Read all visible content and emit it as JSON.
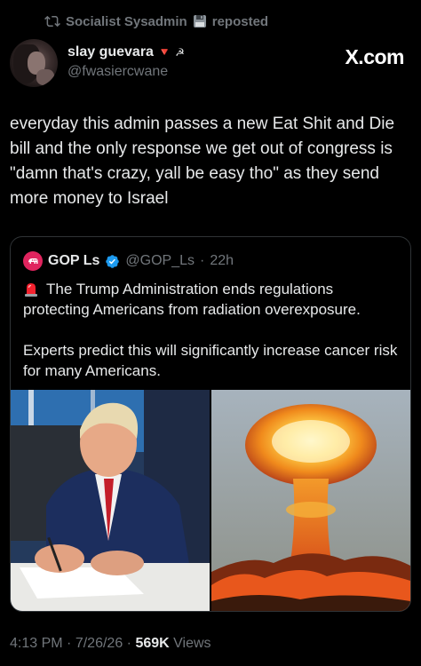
{
  "repost": {
    "reposter_name": "Socialist Sysadmin",
    "label": "reposted",
    "icon": "repost-icon",
    "badge_icon": "floppy-disk-icon"
  },
  "post": {
    "author": {
      "display_name": "slay guevara",
      "flag_emoji": "🔻",
      "symbol": "☭",
      "handle": "@fwasiercwane"
    },
    "logo": "X.com",
    "text": "everyday this admin passes a new Eat Shit and Die bill and the only response we get out of congress is \"damn that's crazy, yall be easy tho\" as they send more money to Israel",
    "quote": {
      "author_name": "GOP Ls",
      "handle": "@GOP_Ls",
      "time": "22h",
      "paragraph_1": "The Trump Administration ends regulations protecting Americans from radiation overexposure.",
      "paragraph_2": "Experts predict this will significantly increase cancer risk for many Americans.",
      "media": [
        {
          "alt_icon": "man-signing-document-photo"
        },
        {
          "alt_icon": "mushroom-cloud-photo"
        }
      ]
    },
    "footer": {
      "time": "4:13 PM",
      "date": "7/26/26",
      "views_count": "569K",
      "views_label": "Views"
    }
  },
  "colors": {
    "background": "#000000",
    "text": "#e7e9ea",
    "muted": "#71767b",
    "border": "#2f3336",
    "verified": "#1d9bf0",
    "gop_red": "#e0245e"
  }
}
